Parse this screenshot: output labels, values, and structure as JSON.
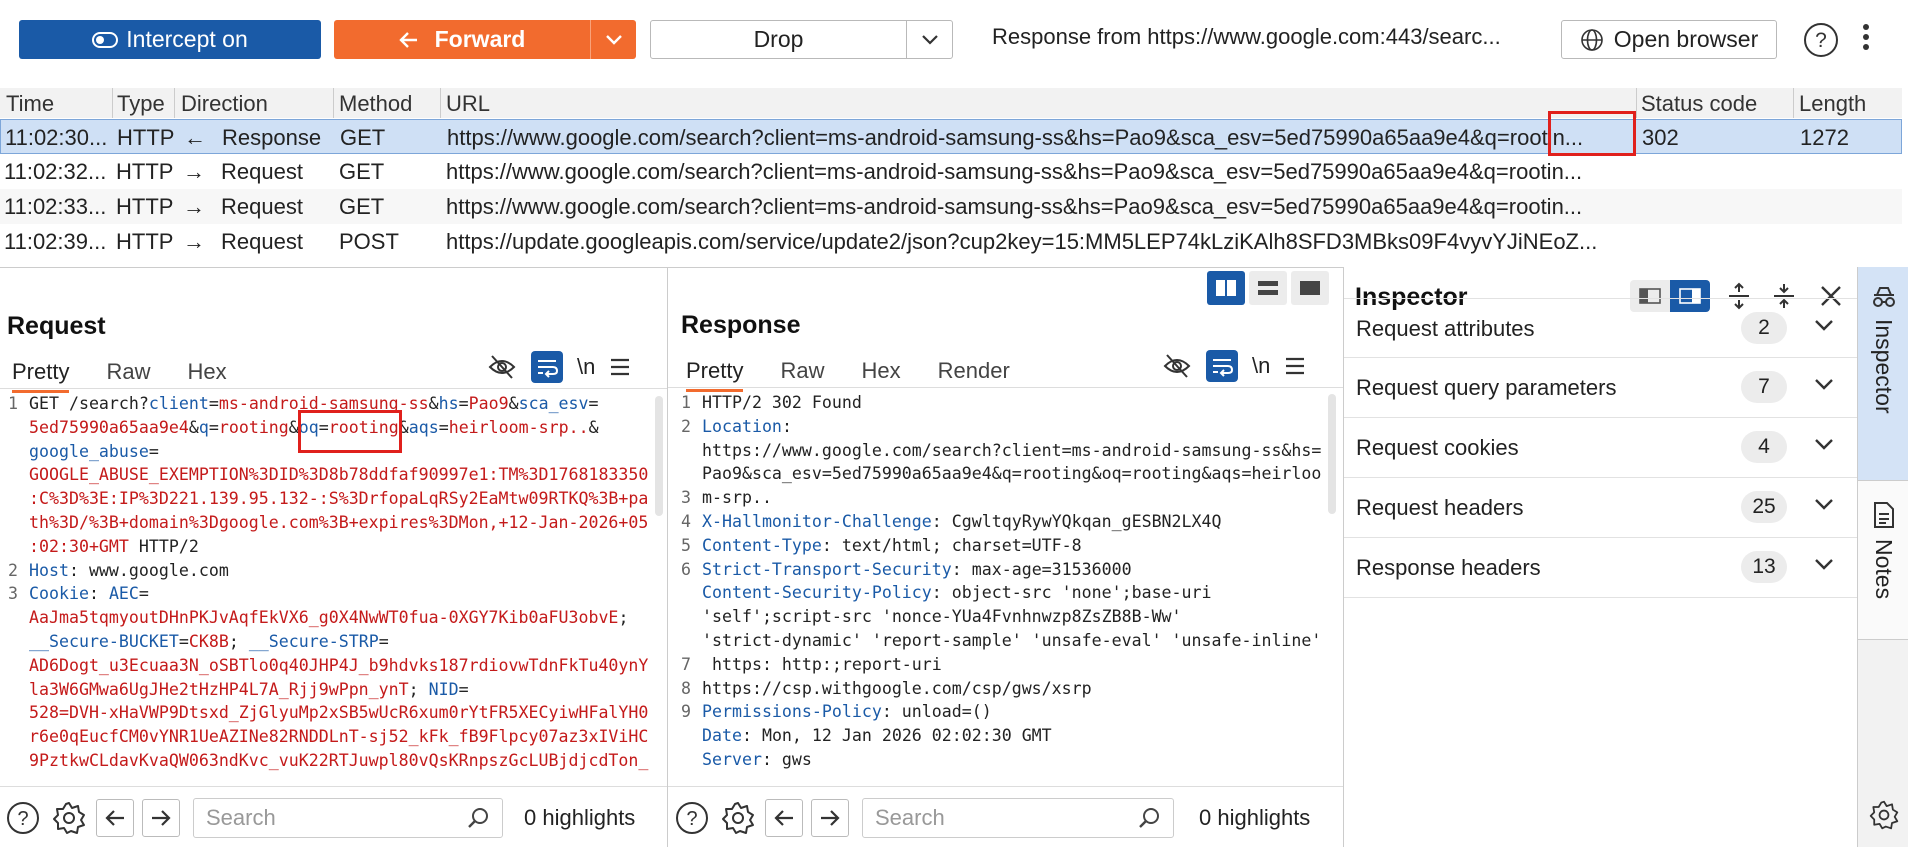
{
  "toolbar": {
    "intercept_label": "Intercept on",
    "forward_label": "Forward",
    "drop_label": "Drop",
    "response_from": "Response from https://www.google.com:443/searc...",
    "open_browser_label": "Open browser"
  },
  "history": {
    "columns": [
      "Time",
      "Type",
      "Direction",
      "Method",
      "URL",
      "Status code",
      "Length"
    ],
    "rows": [
      {
        "time": "11:02:30...",
        "type": "HTTP",
        "arrow": "←",
        "direction": "Response",
        "method": "GET",
        "url": "https://www.google.com/search?client=ms-android-samsung-ss&hs=Pao9&sca_esv=5ed75990a65aa9e4&q=rootin...",
        "status": "302",
        "length": "1272"
      },
      {
        "time": "11:02:32...",
        "type": "HTTP",
        "arrow": "→",
        "direction": "Request",
        "method": "GET",
        "url": "https://www.google.com/search?client=ms-android-samsung-ss&hs=Pao9&sca_esv=5ed75990a65aa9e4&q=rootin...",
        "status": "",
        "length": ""
      },
      {
        "time": "11:02:33...",
        "type": "HTTP",
        "arrow": "→",
        "direction": "Request",
        "method": "GET",
        "url": "https://www.google.com/search?client=ms-android-samsung-ss&hs=Pao9&sca_esv=5ed75990a65aa9e4&q=rootin...",
        "status": "",
        "length": ""
      },
      {
        "time": "11:02:39...",
        "type": "HTTP",
        "arrow": "→",
        "direction": "Request",
        "method": "POST",
        "url": "https://update.googleapis.com/service/update2/json?cup2key=15:MM5LEP74kLziKAlh8SFD3MBks09F4vyvYJiNEoZ...",
        "status": "",
        "length": ""
      }
    ]
  },
  "request": {
    "title": "Request",
    "tabs": [
      "Pretty",
      "Raw",
      "Hex"
    ],
    "active_tab": "Pretty",
    "line_numbers": [
      "1",
      "2",
      "3"
    ],
    "lines": [
      [
        [
          "GET /search?",
          "p"
        ],
        [
          "client",
          "k"
        ],
        [
          "=",
          "p"
        ],
        [
          "ms-android-samsung-ss",
          "v"
        ],
        [
          "&",
          "p"
        ],
        [
          "hs",
          "k"
        ],
        [
          "=",
          "p"
        ],
        [
          "Pao9",
          "v"
        ],
        [
          "&",
          "p"
        ],
        [
          "sca_esv",
          "k"
        ],
        [
          "=",
          "p"
        ]
      ],
      [
        [
          "5ed75990a65aa9e4",
          "v"
        ],
        [
          "&",
          "p"
        ],
        [
          "q",
          "k"
        ],
        [
          "=",
          "p"
        ],
        [
          "rooting",
          "v"
        ],
        [
          "&",
          "p"
        ],
        [
          "oq",
          "k"
        ],
        [
          "=",
          "p"
        ],
        [
          "rooting",
          "v"
        ],
        [
          "&",
          "p"
        ],
        [
          "aqs",
          "k"
        ],
        [
          "=",
          "p"
        ],
        [
          "heirloom-srp..",
          "v"
        ],
        [
          "&",
          "p"
        ]
      ],
      [
        [
          "google_abuse",
          "k"
        ],
        [
          "=",
          "p"
        ]
      ],
      [
        [
          "GOOGLE_ABUSE_EXEMPTION%3DID%3D8b78ddfaf90997e1:TM%3D1768183350",
          "v"
        ]
      ],
      [
        [
          ":C%3D%3E:IP%3D221.139.95.132-:S%3DrfopaLqRSy2EaMtw09RTKQ%3B+pa",
          "v"
        ]
      ],
      [
        [
          "th%3D/%3B+domain%3Dgoogle.com%3B+expires%3DMon,+12-Jan-2026+05",
          "v"
        ]
      ],
      [
        [
          ":02:30+GMT",
          "v"
        ],
        [
          " HTTP/2",
          "p"
        ]
      ],
      [
        [
          "Host",
          "k"
        ],
        [
          ": www.google.com",
          "p"
        ]
      ],
      [
        [
          "Cookie",
          "k"
        ],
        [
          ": ",
          "p"
        ],
        [
          "AEC",
          "k"
        ],
        [
          "=",
          "p"
        ]
      ],
      [
        [
          "AaJma5tqmyoutDHnPKJvAqfEkVX6_g0X4NwWT0fua-0XGY7Kib0aFU3obvE",
          "v"
        ],
        [
          ";",
          "p"
        ]
      ],
      [
        [
          "__Secure-BUCKET",
          "k"
        ],
        [
          "=",
          "p"
        ],
        [
          "CK8B",
          "v"
        ],
        [
          "; ",
          "p"
        ],
        [
          "__Secure-STRP",
          "k"
        ],
        [
          "=",
          "p"
        ]
      ],
      [
        [
          "AD6Dogt_u3Ecuaa3N_oSBTlo0q40JHP4J_b9hdvks187rdiovwTdnFkTu40ynY",
          "v"
        ]
      ],
      [
        [
          "la3W6GMwa6UgJHe2tHzHP4L7A_Rjj9wPpn_ynT",
          "v"
        ],
        [
          "; ",
          "p"
        ],
        [
          "NID",
          "k"
        ],
        [
          "=",
          "p"
        ]
      ],
      [
        [
          "528=DVH-xHaVWP9Dtsxd_ZjGlyuMp2xSB5wUcR6xum0rYtFR5XECyiwHFalYH0",
          "v"
        ]
      ],
      [
        [
          "r6e0qEucfCM0vYNR1UeAZINe82RNDDLnT-sj52_kFk_fB9Flpcy07az3xIViHC",
          "v"
        ]
      ],
      [
        [
          "9PztkwCLdavKvaQW063ndKvc_vuK22RTJuwpl80vQsKRnpszGcLUBjdjcdTon_",
          "v"
        ]
      ]
    ]
  },
  "response": {
    "title": "Response",
    "tabs": [
      "Pretty",
      "Raw",
      "Hex",
      "Render"
    ],
    "active_tab": "Pretty",
    "line_numbers": [
      "1",
      "2",
      "3",
      "4",
      "5",
      "6",
      "7",
      "8",
      "9"
    ],
    "lines": [
      [
        [
          "HTTP/2 302 Found",
          "p"
        ]
      ],
      [
        [
          "Location",
          "k"
        ],
        [
          ":",
          "p"
        ]
      ],
      [
        [
          "https://www.google.com/search?client=ms-android-samsung-ss&hs=",
          "p"
        ]
      ],
      [
        [
          "Pao9&sca_esv=5ed75990a65aa9e4&q=rooting&oq=rooting&aqs=heirloo",
          "p"
        ]
      ],
      [
        [
          "m-srp..",
          "p"
        ]
      ],
      [
        [
          "X-Hallmonitor-Challenge",
          "k"
        ],
        [
          ": CgwltqyRywYQkqan_gESBN2LX4Q",
          "p"
        ]
      ],
      [
        [
          "Content-Type",
          "k"
        ],
        [
          ": text/html; charset=UTF-8",
          "p"
        ]
      ],
      [
        [
          "Strict-Transport-Security",
          "k"
        ],
        [
          ": max-age=31536000",
          "p"
        ]
      ],
      [
        [
          "Content-Security-Policy",
          "k"
        ],
        [
          ": object-src 'none';base-uri",
          "p"
        ]
      ],
      [
        [
          "'self';script-src 'nonce-YUa4Fvnhnwzp8ZsZB8B-Ww'",
          "p"
        ]
      ],
      [
        [
          "'strict-dynamic' 'report-sample' 'unsafe-eval' 'unsafe-inline'",
          "p"
        ]
      ],
      [
        [
          " https: http:;report-uri",
          "p"
        ]
      ],
      [
        [
          "https://csp.withgoogle.com/csp/gws/xsrp",
          "p"
        ]
      ],
      [
        [
          "Permissions-Policy",
          "k"
        ],
        [
          ": unload=()",
          "p"
        ]
      ],
      [
        [
          "Date",
          "k"
        ],
        [
          ": Mon, 12 Jan 2026 02:02:30 GMT",
          "p"
        ]
      ],
      [
        [
          "Server",
          "k"
        ],
        [
          ": gws",
          "p"
        ]
      ]
    ]
  },
  "footer": {
    "search_placeholder": "Search",
    "highlights": "0 highlights"
  },
  "inspector": {
    "title": "Inspector",
    "sections": [
      {
        "label": "Request attributes",
        "count": "2"
      },
      {
        "label": "Request query parameters",
        "count": "7"
      },
      {
        "label": "Request cookies",
        "count": "4"
      },
      {
        "label": "Request headers",
        "count": "25"
      },
      {
        "label": "Response headers",
        "count": "13"
      }
    ]
  },
  "side_tabs": [
    "Inspector",
    "Notes"
  ],
  "colors": {
    "accent_orange": "#f26b2e",
    "accent_blue": "#1a5aa7",
    "highlight_red": "#e0201c",
    "selected_row": "#cfe0f5"
  }
}
